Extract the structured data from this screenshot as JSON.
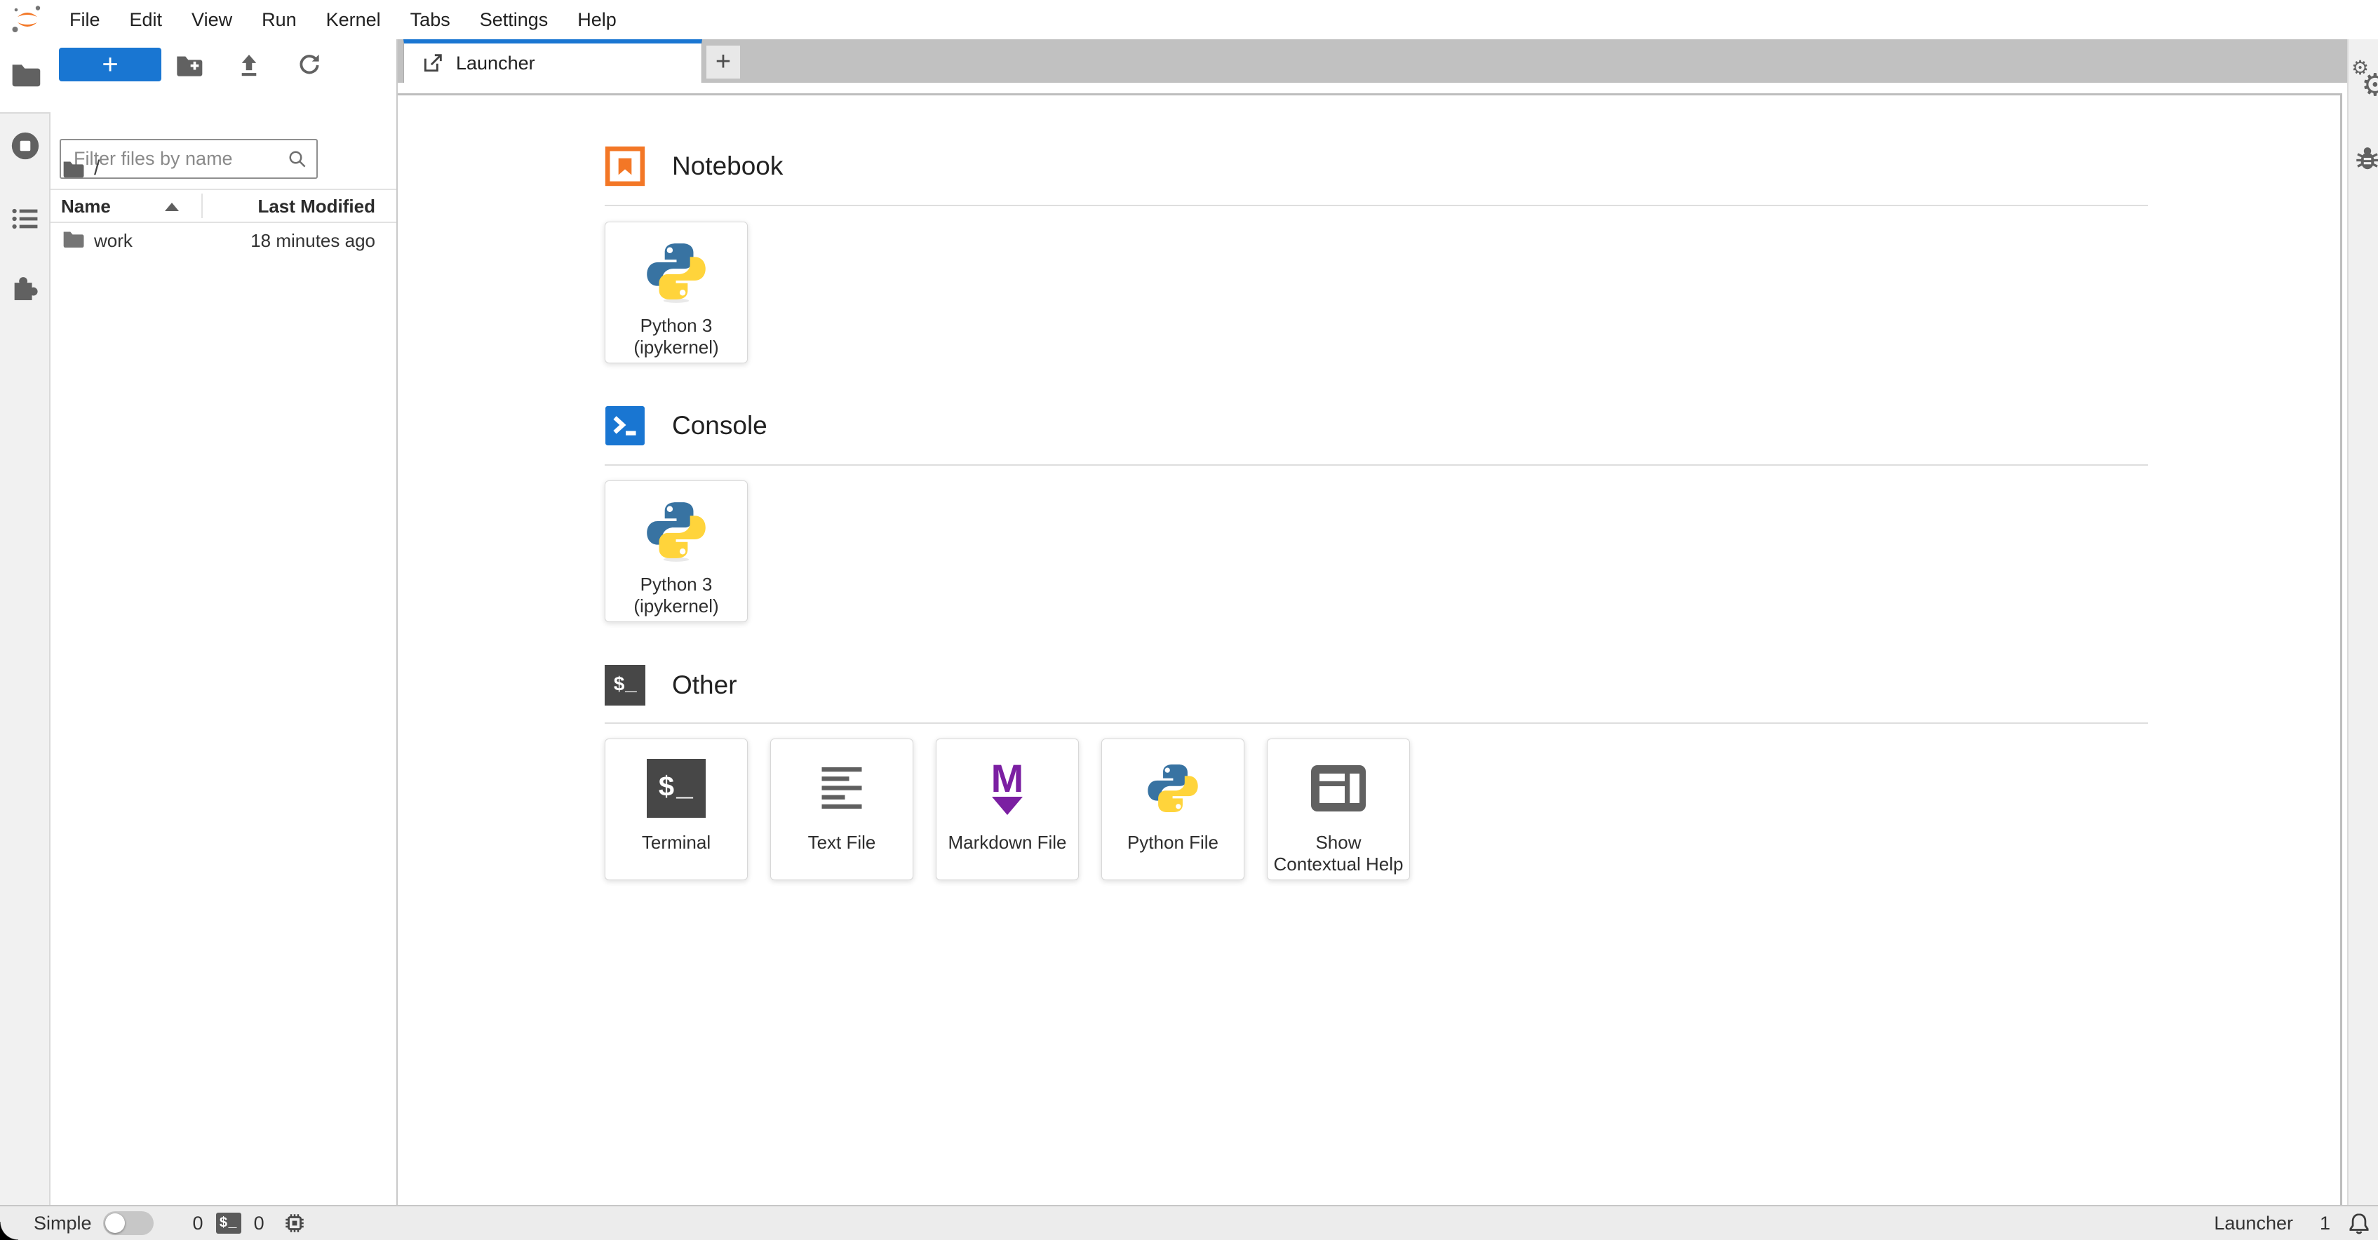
{
  "menu": {
    "items": [
      "File",
      "Edit",
      "View",
      "Run",
      "Kernel",
      "Tabs",
      "Settings",
      "Help"
    ]
  },
  "left_sidebar": {
    "tabs": [
      "file-browser",
      "running-sessions",
      "table-of-contents",
      "extensions"
    ]
  },
  "file_browser": {
    "new_launcher_label": "+",
    "filter_placeholder": "Filter files by name",
    "breadcrumb": "/",
    "columns": {
      "name": "Name",
      "last_modified": "Last Modified"
    },
    "rows": [
      {
        "type": "folder",
        "name": "work",
        "last_modified": "18 minutes ago"
      }
    ]
  },
  "tab_bar": {
    "tabs": [
      {
        "label": "Launcher",
        "active": true
      }
    ],
    "add_tab_label": "+"
  },
  "launcher": {
    "sections": [
      {
        "title": "Notebook",
        "items": [
          {
            "label": "Python 3\n(ipykernel)"
          }
        ]
      },
      {
        "title": "Console",
        "items": [
          {
            "label": "Python 3\n(ipykernel)"
          }
        ]
      },
      {
        "title": "Other",
        "items": [
          {
            "label": "Terminal"
          },
          {
            "label": "Text File"
          },
          {
            "label": "Markdown File"
          },
          {
            "label": "Python File"
          },
          {
            "label": "Show\nContextual Help"
          }
        ]
      }
    ]
  },
  "right_sidebar": {
    "tabs": [
      "property-inspector",
      "debugger"
    ]
  },
  "status_bar": {
    "mode_label": "Simple",
    "terminals_count": "0",
    "kernels_count": "0",
    "current_activity": "Launcher",
    "notifications_count": "1"
  },
  "icons": {
    "terminal_glyph": "$_",
    "markdown_letter": "M",
    "gear_glyph": "⚙"
  },
  "colors": {
    "accent_blue": "#1976d2",
    "notebook_orange": "#F37726",
    "markdown_purple": "#7B1FA2",
    "python_blue": "#3873A2",
    "python_yellow": "#FFD43B",
    "terminal_dark": "#474747",
    "icon_gray": "#616161"
  }
}
